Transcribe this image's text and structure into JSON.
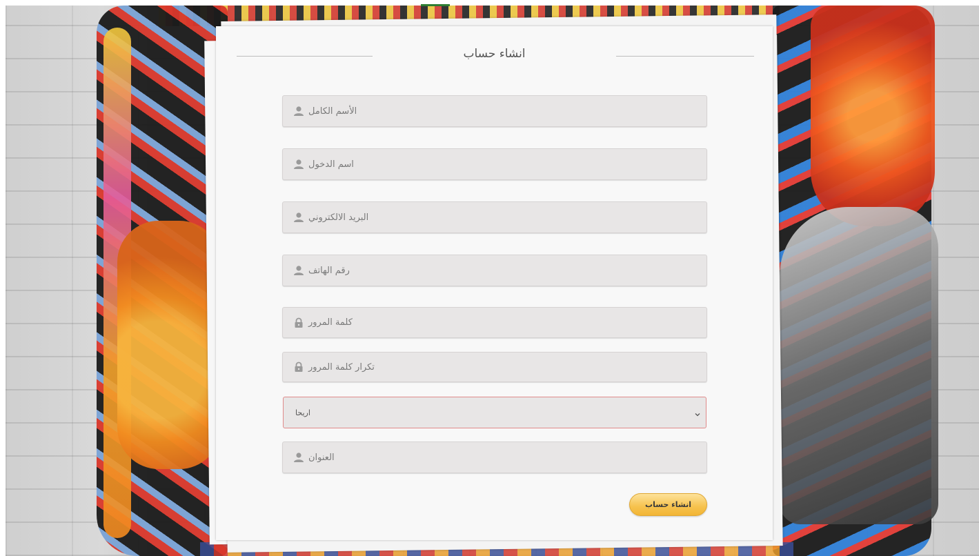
{
  "form": {
    "title": "انشاء حساب",
    "fields": {
      "full_name": {
        "placeholder": "الأسم الكامل",
        "icon": "user-icon"
      },
      "username": {
        "placeholder": "اسم الدخول",
        "icon": "user-icon"
      },
      "email": {
        "placeholder": "البريد الالكتروني",
        "icon": "user-icon"
      },
      "phone": {
        "placeholder": "رقم الهاتف",
        "icon": "user-icon"
      },
      "password": {
        "placeholder": "كلمة المرور",
        "icon": "lock-icon"
      },
      "password_confirm": {
        "placeholder": "تكرار كلمة المرور",
        "icon": "lock-icon"
      },
      "city_select": {
        "selected": "اريحا",
        "icon": "chevron-down-icon"
      },
      "address": {
        "placeholder": "العنوان",
        "icon": "user-icon"
      }
    },
    "submit_label": "انشاء حساب"
  },
  "colors": {
    "field_bg": "#e8e6e6",
    "select_border": "#e08a8a",
    "button_gradient_top": "#fde29b",
    "button_gradient_bottom": "#f2b536"
  }
}
